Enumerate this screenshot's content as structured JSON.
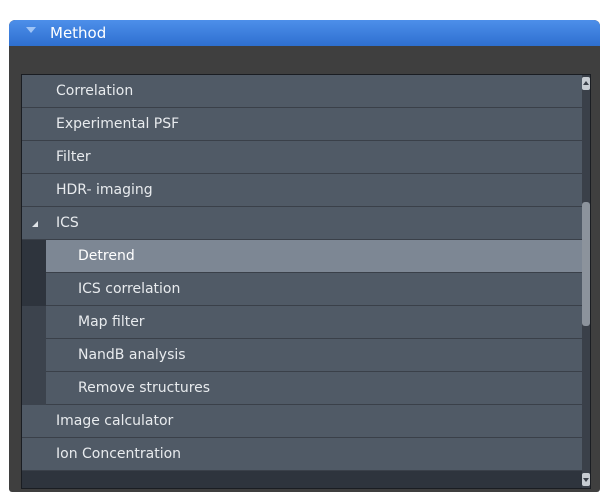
{
  "panel": {
    "title": "Method",
    "expanded": true
  },
  "list": {
    "items": [
      {
        "label": "Correlation",
        "level": 0
      },
      {
        "label": "Experimental PSF",
        "level": 0
      },
      {
        "label": "Filter",
        "level": 0
      },
      {
        "label": "HDR- imaging",
        "level": 0
      },
      {
        "label": "ICS",
        "level": 0,
        "expanded": true
      },
      {
        "label": "Detrend",
        "level": 1,
        "selected": true
      },
      {
        "label": "ICS correlation",
        "level": 1
      },
      {
        "label": "Map filter",
        "level": 1
      },
      {
        "label": "NandB analysis",
        "level": 1
      },
      {
        "label": "Remove structures",
        "level": 1
      },
      {
        "label": "Image calculator",
        "level": 0
      },
      {
        "label": "Ion Concentration",
        "level": 0
      }
    ]
  },
  "colors": {
    "header_accent": "#3b7fe0",
    "selected_row": "#7d8794"
  }
}
